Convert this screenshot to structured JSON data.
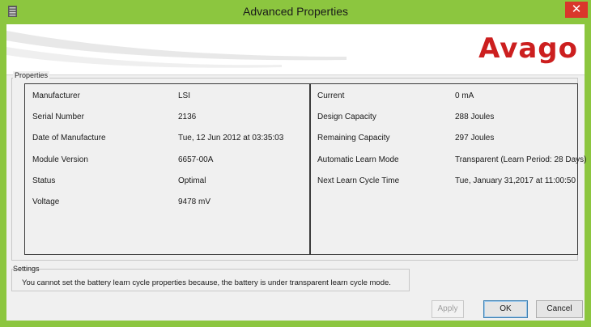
{
  "window": {
    "title": "Advanced Properties",
    "close_glyph": "✕",
    "brand": "Avago"
  },
  "properties": {
    "legend": "Properties",
    "left": [
      {
        "label": "Manufacturer",
        "value": "LSI"
      },
      {
        "label": "Serial Number",
        "value": "2136"
      },
      {
        "label": "Date of Manufacture",
        "value": "Tue, 12 Jun 2012 at 03:35:03"
      },
      {
        "label": "Module Version",
        "value": "6657-00A"
      },
      {
        "label": "Status",
        "value": "Optimal"
      },
      {
        "label": "Voltage",
        "value": "9478 mV"
      }
    ],
    "right": [
      {
        "label": "Current",
        "value": "0 mA"
      },
      {
        "label": "Design Capacity",
        "value": "288 Joules"
      },
      {
        "label": "Remaining Capacity",
        "value": "297 Joules"
      },
      {
        "label": "Automatic Learn Mode",
        "value": "Transparent (Learn Period: 28 Days)"
      },
      {
        "label": "Next Learn Cycle Time",
        "value": "Tue, January 31,2017 at 11:00:50"
      }
    ]
  },
  "settings": {
    "legend": "Settings",
    "message": "You cannot set the battery learn cycle properties because, the battery is under transparent learn cycle mode."
  },
  "buttons": {
    "apply": "Apply",
    "ok": "OK",
    "cancel": "Cancel"
  },
  "colors": {
    "frame": "#8cc63f",
    "close": "#d9372b",
    "brand": "#cc1f1f"
  },
  "icons": {
    "app": "battery-app-icon",
    "close": "close-icon"
  }
}
